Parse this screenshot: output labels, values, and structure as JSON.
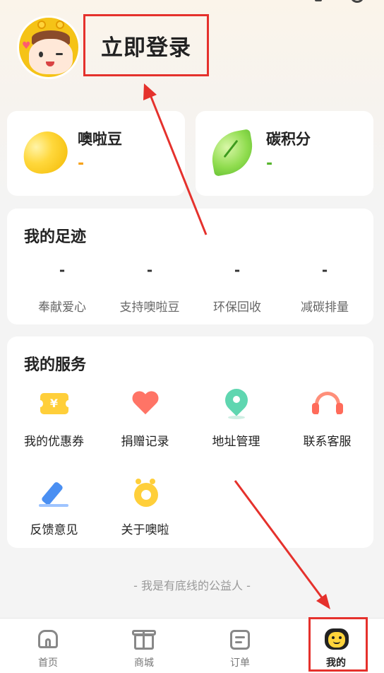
{
  "header": {
    "login_label": "立即登录"
  },
  "stats": [
    {
      "title": "噢啦豆",
      "value": "-"
    },
    {
      "title": "碳积分",
      "value": "-"
    }
  ],
  "footprint": {
    "title": "我的足迹",
    "items": [
      {
        "value": "-",
        "label": "奉献爱心"
      },
      {
        "value": "-",
        "label": "支持噢啦豆"
      },
      {
        "value": "-",
        "label": "环保回收"
      },
      {
        "value": "-",
        "label": "减碳排量"
      }
    ]
  },
  "services": {
    "title": "我的服务",
    "items": [
      {
        "label": "我的优惠券",
        "icon": "coupon-icon"
      },
      {
        "label": "捐赠记录",
        "icon": "heart-icon"
      },
      {
        "label": "地址管理",
        "icon": "location-pin-icon"
      },
      {
        "label": "联系客服",
        "icon": "headset-icon"
      },
      {
        "label": "反馈意见",
        "icon": "pen-icon"
      },
      {
        "label": "关于噢啦",
        "icon": "logo-icon"
      }
    ]
  },
  "slogan": "- 我是有底线的公益人 -",
  "coupon_glyph": "¥",
  "nav": [
    {
      "label": "首页",
      "icon": "home-icon"
    },
    {
      "label": "商城",
      "icon": "gift-icon"
    },
    {
      "label": "订单",
      "icon": "order-icon"
    },
    {
      "label": "我的",
      "icon": "profile-icon",
      "active": true
    }
  ],
  "colors": {
    "accent_orange": "#f7a21b",
    "accent_green": "#56b52c",
    "annotation_red": "#e5312c"
  }
}
